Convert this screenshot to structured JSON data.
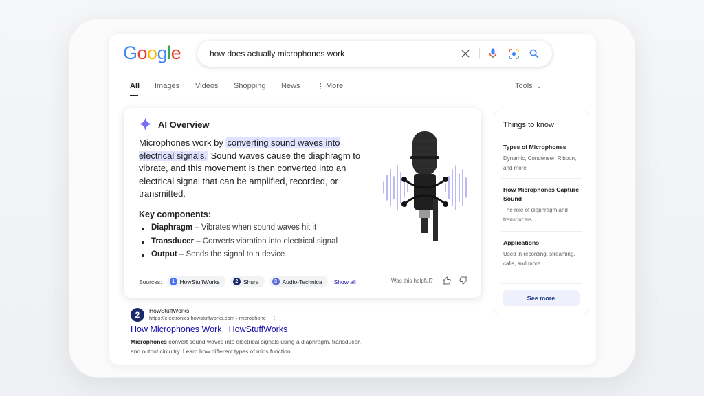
{
  "search": {
    "logo": [
      "G",
      "o",
      "o",
      "g",
      "l",
      "e"
    ],
    "logo_colors": [
      "#4285F4",
      "#EA4335",
      "#FBBC05",
      "#4285F4",
      "#34A853",
      "#EA4335"
    ],
    "query": "how does actually microphones work",
    "icons": [
      "clear-icon",
      "voice-search-icon",
      "lens-icon",
      "search-icon"
    ]
  },
  "tabs": [
    "All",
    "Images",
    "Videos",
    "Shopping",
    "News",
    "More"
  ],
  "active_tab": "All",
  "tools_label": "Tools",
  "ai_overview": {
    "title": "AI Overview",
    "body_before": "Microphones work by ",
    "body_highlight": "converting sound waves into electrical signals.",
    "body_after": " Sound waves cause the diaphragm to vibrate, and this movement is then converted into an electrical signal that can be amplified, recorded, or transmitted.",
    "key_title": "Key components:",
    "components": [
      {
        "term": "Diaphragm",
        "desc": " – Vibrates when sound waves hit it"
      },
      {
        "term": "Transducer",
        "desc": " – Converts vibration into electrical signal"
      },
      {
        "term": "Output",
        "desc": " – Sends the signal to a device"
      }
    ],
    "sources_label": "Sources:",
    "sources": [
      {
        "num": "1",
        "name": "HowStuffWorks",
        "color": "#4a6ef5"
      },
      {
        "num": "2",
        "name": "Shure",
        "color": "#1a2a6c"
      },
      {
        "num": "3",
        "name": "Audio-Technica",
        "color": "#5b6bd8"
      }
    ],
    "show_all": "Show all",
    "helpful": "Was this helpful?",
    "accent": "#7b6cf6"
  },
  "things_to_know": {
    "title": "Things to know",
    "items": [
      {
        "head": "Types of Microphones",
        "sub": "Dynamic, Condenser, Ribbon, and more"
      },
      {
        "head": "How Microphones Capture Sound",
        "sub": "The role of diaphragm and transducers"
      },
      {
        "head": "Applications",
        "sub": "Used in recording, streaming, calls, and more"
      }
    ],
    "see_more": "See more"
  },
  "result": {
    "favicon": "2",
    "site_name": "HowStuffWorks",
    "url": "https://electronics.howstuffworks.com › microphone",
    "title": "How Microphones Work | HowStuffWorks",
    "snippet_bold": "Microphones",
    "snippet_rest": " convert sound waves into electrical signals using a diaphragm, transducer, and output circuitry. Learn how different types of mics function."
  }
}
